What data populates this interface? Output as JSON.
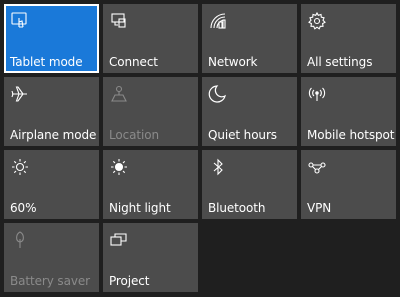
{
  "background": "#1f1f1f",
  "tile_color": "#4c4c4c",
  "accent": "#1a79d9",
  "disabled_text": "#8a8a8a",
  "tiles": [
    {
      "label": "Tablet mode",
      "icon": "tablet-mode-icon",
      "state": "on"
    },
    {
      "label": "Connect",
      "icon": "connect-icon",
      "state": "off"
    },
    {
      "label": "Network",
      "icon": "network-icon",
      "state": "off"
    },
    {
      "label": "All settings",
      "icon": "gear-icon",
      "state": "off"
    },
    {
      "label": "Airplane mode",
      "icon": "airplane-icon",
      "state": "off"
    },
    {
      "label": "Location",
      "icon": "location-icon",
      "state": "disabled"
    },
    {
      "label": "Quiet hours",
      "icon": "moon-icon",
      "state": "off"
    },
    {
      "label": "Mobile hotspot",
      "icon": "hotspot-icon",
      "state": "off"
    },
    {
      "label": "60%",
      "icon": "brightness-icon",
      "state": "off"
    },
    {
      "label": "Night light",
      "icon": "night-light-icon",
      "state": "off"
    },
    {
      "label": "Bluetooth",
      "icon": "bluetooth-icon",
      "state": "off"
    },
    {
      "label": "VPN",
      "icon": "vpn-icon",
      "state": "off"
    },
    {
      "label": "Battery saver",
      "icon": "battery-saver-icon",
      "state": "disabled"
    },
    {
      "label": "Project",
      "icon": "project-icon",
      "state": "off"
    }
  ]
}
